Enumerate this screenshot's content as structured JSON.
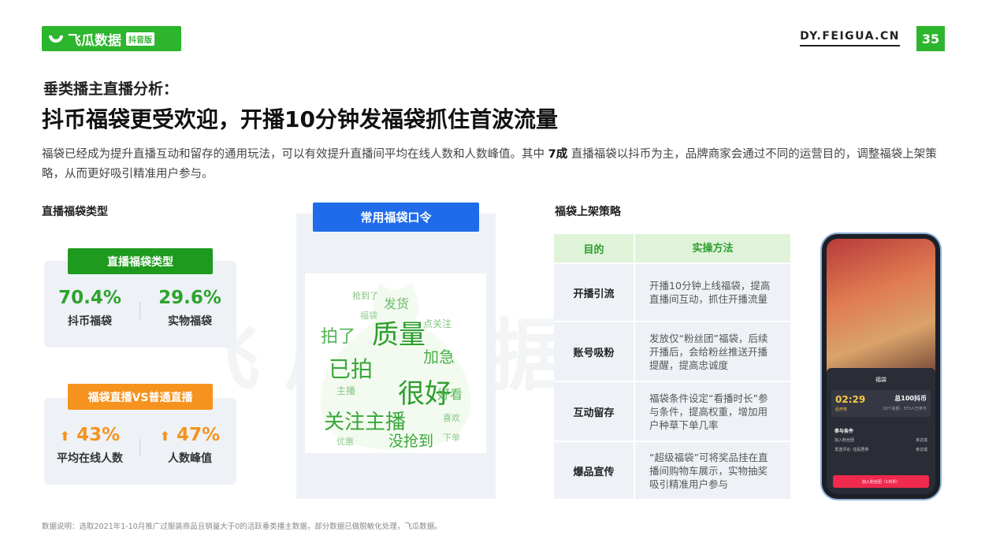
{
  "header": {
    "logo_text": "飞瓜数据",
    "logo_badge": "抖音版",
    "site": "DY.FEIGUA.CN",
    "page_number": "35"
  },
  "watermark": "飞瓜数据",
  "subtitle": "垂类播主直播分析：",
  "title": "抖币福袋更受欢迎，开播10分钟发福袋抓住首波流量",
  "description": {
    "part1": "福袋已经成为提升直播互动和留存的通用玩法，可以有效提升直播间平均在线人数和人数峰值。其中 ",
    "bold": "7成",
    "part2": " 直播福袋以抖币为主，品牌商家会通过不同的运营目的，调整福袋上架策略，从而更好吸引精准用户参与。"
  },
  "left": {
    "section_label": "直播福袋类型",
    "card1": {
      "pill": "直播福袋类型",
      "color": "#1e9b1e",
      "stats": [
        {
          "value": "70.4%",
          "label": "抖币福袋"
        },
        {
          "value": "29.6%",
          "label": "实物福袋"
        }
      ]
    },
    "card2": {
      "pill": "福袋直播VS普通直播",
      "color": "#f5931e",
      "stats": [
        {
          "value": "43%",
          "label": "平均在线人数"
        },
        {
          "value": "47%",
          "label": "人数峰值"
        }
      ]
    }
  },
  "middle": {
    "button": "常用福袋口令",
    "words": [
      "关注主播",
      "质量",
      "很好",
      "已拍",
      "拍了",
      "加急",
      "没抢到",
      "好看",
      "点关注",
      "发货",
      "主播",
      "喜欢",
      "抢到了",
      "优惠",
      "下单",
      "福袋"
    ]
  },
  "right": {
    "section_label": "福袋上架策略",
    "table": {
      "headers": [
        "目的",
        "实操方法"
      ],
      "rows": [
        {
          "purpose": "开播引流",
          "method": "开播10分钟上线福袋，提高直播间互动，抓住开播流量"
        },
        {
          "purpose": "账号吸粉",
          "method": "发放仅“粉丝团”福袋，后续开播后，会给粉丝推送开播提醒，提高忠诚度"
        },
        {
          "purpose": "互动留存",
          "method": "福袋条件设定“看播时长”参与条件，提高权重，增加用户种草下单几率"
        },
        {
          "purpose": "爆品宣传",
          "method": "“超级福袋”可将奖品挂在直播间购物车展示，实物抽奖吸引精准用户参与"
        }
      ]
    },
    "phone": {
      "panel_title": "福袋",
      "timer": "02:29",
      "timer_sub": "后开奖",
      "prize": "总100抖币",
      "prize_sub": "10个名额 · 373人已参与",
      "cond_title": "参与条件",
      "conditions": [
        {
          "label": "加入粉丝团",
          "status": "未达成"
        },
        {
          "label": "发送评论: 住民居停",
          "status": "未达成"
        }
      ],
      "action": "加入粉丝团（1抖币）"
    }
  },
  "footnote": "数据说明：选取2021年1-10月推广过服装商品且销量大于0的活跃垂类播主数据，部分数据已做脱敏化处理，飞瓜数据。"
}
